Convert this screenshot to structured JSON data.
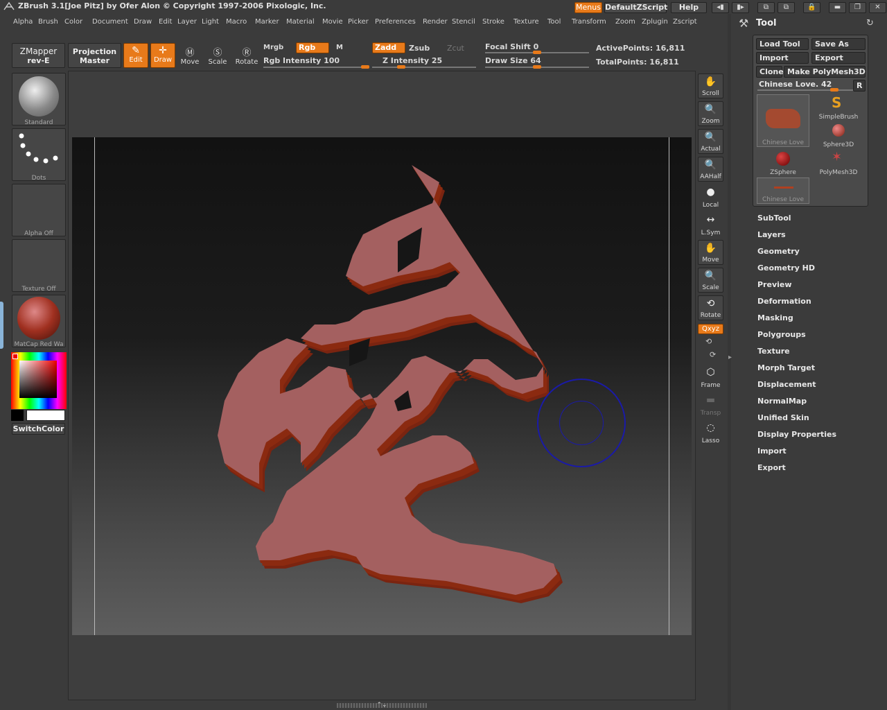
{
  "app": {
    "title": "ZBrush   3.1[Joe Pitz] by Ofer Alon © Copyright 1997-2006 Pixologic, Inc."
  },
  "topright": {
    "menus": "Menus",
    "script": "DefaultZScript",
    "help": "Help"
  },
  "menu": [
    "Alpha",
    "Brush",
    "Color",
    "Document",
    "Draw",
    "Edit",
    "Layer",
    "Light",
    "Macro",
    "Marker",
    "Material",
    "Movie",
    "Picker",
    "Preferences",
    "Render",
    "Stencil",
    "Stroke",
    "Texture",
    "Tool",
    "Transform",
    "Zoom",
    "Zplugin",
    "Zscript"
  ],
  "toolbar": {
    "zmapper": "ZMapper",
    "zmapper_sub": "rev-E",
    "projection": "Projection",
    "projection_sub": "Master",
    "edit": "Edit",
    "draw": "Draw",
    "move": "Move",
    "scale": "Scale",
    "rotate": "Rotate",
    "mrgb": "Mrgb",
    "rgb": "Rgb",
    "m": "M",
    "rgb_intensity": "Rgb Intensity 100",
    "zadd": "Zadd",
    "zsub": "Zsub",
    "zcut": "Zcut",
    "z_intensity": "Z Intensity 25",
    "focal_shift": "Focal Shift 0",
    "draw_size": "Draw Size 64",
    "active_points": "ActivePoints: 16,811",
    "total_points": "TotalPoints: 16,811"
  },
  "left": {
    "standard": "Standard",
    "dots": "Dots",
    "alpha": "Alpha Off",
    "texture": "Texture Off",
    "material": "MatCap Red Wa",
    "switchcolor": "SwitchColor"
  },
  "right_strip": [
    "Scroll",
    "Zoom",
    "Actual",
    "AAHalf",
    "Local",
    "L.Sym",
    "Move",
    "Scale",
    "Rotate",
    "Frame",
    "Transp",
    "Lasso"
  ],
  "right_strip_xyz": "Qxyz",
  "tool": {
    "title": "Tool",
    "load_tool": "Load Tool",
    "save_as": "Save As",
    "import": "Import",
    "export": "Export",
    "clone": "Clone",
    "make_polymesh": "Make PolyMesh3D",
    "current": "Chinese Love. 42",
    "r": "R",
    "thumbs": [
      "Chinese Love",
      "SimpleBrush",
      "Sphere3D",
      "ZSphere",
      "PolyMesh3D",
      "Chinese Love"
    ],
    "subpalettes": [
      "SubTool",
      "Layers",
      "Geometry",
      "Geometry HD",
      "Preview",
      "Deformation",
      "Masking",
      "Polygroups",
      "Texture",
      "Morph Target",
      "Displacement",
      "NormalMap",
      "Unified Skin",
      "Display Properties",
      "Import",
      "Export"
    ]
  },
  "colors": {
    "accent": "#e87a1a",
    "model": "#a46060",
    "model_side": "#8b2a10"
  }
}
